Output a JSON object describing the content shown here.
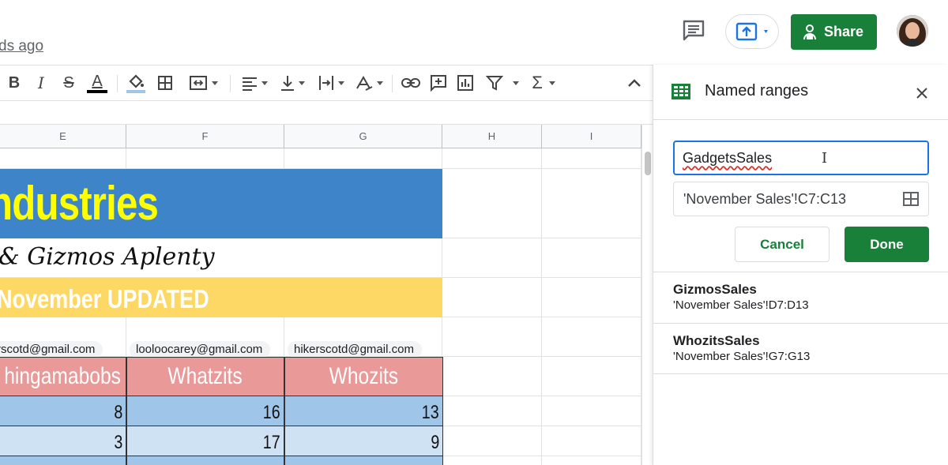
{
  "topbar": {
    "last_edit": "ds ago",
    "share_label": "Share"
  },
  "toolbar": {
    "items": [
      "bold-icon",
      "italic-icon",
      "strikethrough-icon",
      "text-color-icon",
      "fill-color-icon",
      "borders-icon",
      "merge-cells-icon",
      "horizontal-align-icon",
      "vertical-align-icon",
      "text-wrap-icon",
      "text-rotation-icon",
      "link-icon",
      "comment-icon",
      "chart-icon",
      "filter-icon",
      "functions-icon",
      "collapse-icon"
    ],
    "bold": "B",
    "italic": "I",
    "strike": "S",
    "textcolor": "A",
    "sigma": "Σ"
  },
  "grid": {
    "columns": [
      "E",
      "F",
      "G",
      "H",
      "I"
    ],
    "title": "ndustries",
    "subtitle": "& Gizmos Aplenty",
    "banner": "November UPDATED",
    "emails": [
      "rscotd@gmail.com",
      "looloocarey@gmail.com",
      "hikerscotd@gmail.com"
    ],
    "headers": [
      "hingamabobs",
      "Whatzits",
      "Whozits"
    ],
    "rows": [
      [
        "8",
        "16",
        "13"
      ],
      [
        "3",
        "17",
        "9"
      ]
    ]
  },
  "panel": {
    "title": "Named ranges",
    "name_value": "GadgetsSales",
    "range_value": "'November Sales'!C7:C13",
    "cancel_label": "Cancel",
    "done_label": "Done",
    "ranges": [
      {
        "name": "GizmosSales",
        "range": "'November Sales'!D7:D13"
      },
      {
        "name": "WhozitsSales",
        "range": "'November Sales'!G7:G13"
      }
    ]
  },
  "colors": {
    "accent_green": "#188038",
    "focus_blue": "#1a73e8",
    "title_blue": "#3d85c8",
    "title_yellow": "#ffff00",
    "banner_yellow": "#fdd865",
    "header_pink": "#ea9999",
    "row_blue_dark": "#9fc5e8",
    "row_blue_light": "#cfe2f3"
  }
}
